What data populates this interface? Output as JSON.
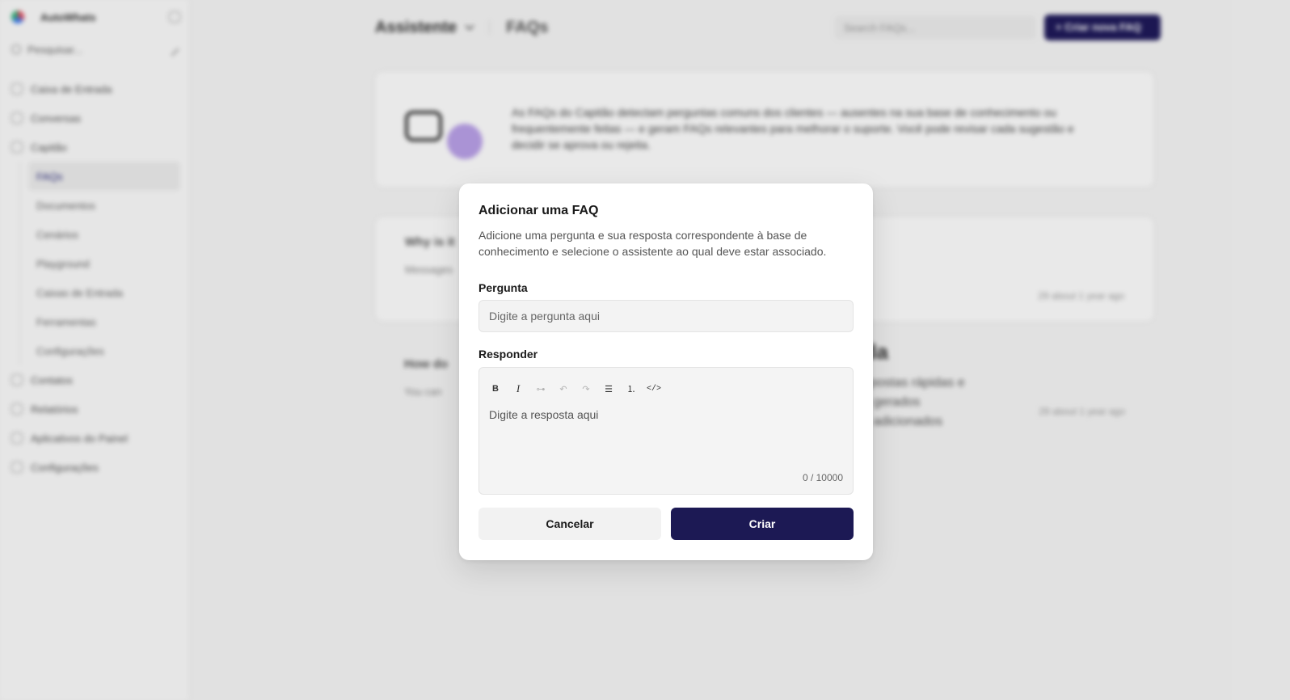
{
  "background": {
    "sidebar": {
      "account_name": "AutoWhats",
      "search_placeholder": "Pesquisar...",
      "items": [
        {
          "label": "Caixa de Entrada"
        },
        {
          "label": "Conversas"
        },
        {
          "label": "Capitão"
        }
      ],
      "captain_subitems": [
        {
          "label": "FAQs"
        },
        {
          "label": "Documentos"
        },
        {
          "label": "Cenários"
        },
        {
          "label": "Playground"
        },
        {
          "label": "Caixas de Entrada"
        },
        {
          "label": "Ferramentas"
        },
        {
          "label": "Configurações"
        }
      ],
      "bottom_items": [
        {
          "label": "Contatos"
        },
        {
          "label": "Relatórios"
        },
        {
          "label": "Aplicativos do Painel"
        },
        {
          "label": "Configurações"
        }
      ]
    },
    "header": {
      "assistant_label": "Assistente",
      "page_title": "FAQs",
      "search_placeholder": "Search FAQs...",
      "create_button": "+ Criar nova FAQ"
    },
    "banner_text": "As FAQs do Capitão detectam perguntas comuns dos clientes — ausentes na sua base de conhecimento ou frequentemente feitas — e geram FAQs relevantes para melhorar o suporte. Você pode revisar cada sugestão e decidir se aprova ou rejeita.",
    "faq_cards": [
      {
        "question": "Why is it",
        "answer": "Messages",
        "date": "29 about 1 year ago"
      },
      {
        "question": "How do",
        "answer": "You can",
        "date": "29 about 1 year ago"
      }
    ],
    "empty_state_title": "ada",
    "empty_state_text": "respostas rápidas e\nser gerados\nser adicionados"
  },
  "modal": {
    "title": "Adicionar uma FAQ",
    "description": "Adicione uma pergunta e sua resposta correspondente à base de conhecimento e selecione o assistente ao qual deve estar associado.",
    "question_label": "Pergunta",
    "question_placeholder": "Digite a pergunta aqui",
    "answer_label": "Responder",
    "answer_placeholder": "Digite a resposta aqui",
    "counter": "0 / 10000",
    "cancel_label": "Cancelar",
    "create_label": "Criar",
    "toolbar": [
      {
        "icon": "bold-icon",
        "glyph": "B"
      },
      {
        "icon": "italic-icon",
        "glyph": "I"
      },
      {
        "icon": "link-icon",
        "glyph": "⊶"
      },
      {
        "icon": "undo-icon",
        "glyph": "↶"
      },
      {
        "icon": "redo-icon",
        "glyph": "↷"
      },
      {
        "icon": "bullet-list-icon",
        "glyph": "☰"
      },
      {
        "icon": "ordered-list-icon",
        "glyph": "⒈"
      },
      {
        "icon": "code-icon",
        "glyph": "</>"
      }
    ]
  },
  "colors": {
    "primary": "#1c1954",
    "overlay": "rgba(0,0,0,0.08)"
  }
}
